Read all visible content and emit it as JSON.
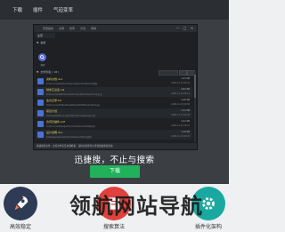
{
  "topnav": {
    "items": [
      "下载",
      "插件",
      "气迫变率"
    ]
  },
  "window": {
    "menu": [
      "安照插搜",
      "注明",
      "搜索",
      "方法",
      "帮助"
    ],
    "controls": [
      "—",
      "□",
      "✕"
    ],
    "tab": "主页",
    "pinned_header": "常用",
    "pinned_label": "搜索",
    "list_header": "文件列表 ( 18 )",
    "rows": [
      {
        "name": "资料文档.doc",
        "path": "D:\\Documents\\Work\\Project\\Reports\\2020\\Q4\\资料",
        "size": "1.21 KB",
        "date": "2020-11-23 09:52"
      },
      {
        "name": "财务汇总表.xls",
        "path": "D:\\Documents\\Finance\\Summary\\Monthly\\Archive\\汇总",
        "size": "2.81 KB",
        "date": "2020-11-23 09:51"
      },
      {
        "name": "会议记录.txt",
        "path": "D:\\Documents\\Meetings\\Notes\\2020\\November\\记录",
        "size": "1.20 KB",
        "date": "2020-11-23 09:50"
      },
      {
        "name": "项目计划",
        "path": "D:\\Projects\\Planning\\Drafts\\Internal\\Review\\计划",
        "size": "1.21 KB",
        "date": "2020-11-23 09:48"
      },
      {
        "name": "合同扫描件.pdf",
        "path": "D:\\Documents\\Legal\\Contracts\\Scans\\2020\\合同",
        "size": "2.21 KB",
        "date": "2020-11-23 09:47"
      },
      {
        "name": "设计说明.doc",
        "path": "D:\\Design\\Specs\\Product\\Version2\\Final\\说明",
        "size": "1.20 KB",
        "date": "2020-11-23 09:45"
      }
    ],
    "status": "快速搜索文件，支持文件名及内容检索，多种过滤条件让查找更加便捷高效"
  },
  "hero": {
    "tagline": "迅捷搜，不止与搜索",
    "download_label": "下载"
  },
  "features": [
    {
      "label": "高效稳定",
      "icon": "rocket-icon",
      "color": "#2f3a55"
    },
    {
      "label": "搜索算法",
      "icon": "book-icon",
      "color": "#e0413c"
    },
    {
      "label": "插件化架构",
      "icon": "gear-icon",
      "color": "#1aa9a0"
    }
  ],
  "watermark": "领航网站导航"
}
